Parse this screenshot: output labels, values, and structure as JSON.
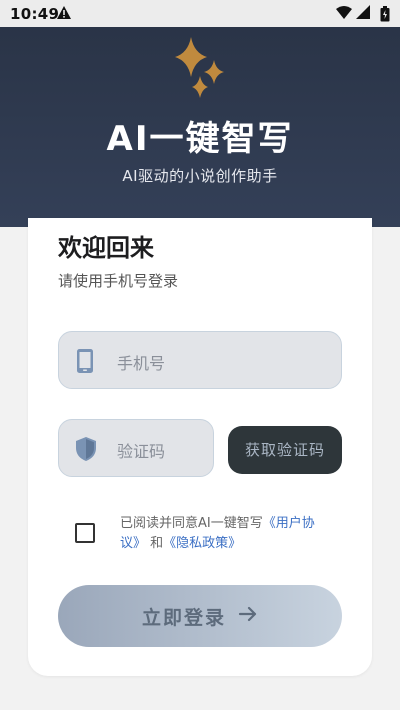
{
  "status_bar": {
    "time": "10:49"
  },
  "header": {
    "title": "AI一键智写",
    "subtitle": "AI驱动的小说创作助手",
    "logo_icon": "sparkle-stars-icon",
    "background_color": "#2a3447"
  },
  "login": {
    "welcome": "欢迎回来",
    "hint": "请使用手机号登录",
    "phone_field": {
      "placeholder": "手机号",
      "value": "",
      "icon": "smartphone-icon"
    },
    "code_field": {
      "placeholder": "验证码",
      "value": "",
      "icon": "shield-icon"
    },
    "send_code_button": "获取验证码",
    "agreement": {
      "checked": false,
      "prefix": "已阅读并同意AI一键智写",
      "user_agreement": "《用户协议》",
      "conjunction": "和",
      "privacy_policy": "《隐私政策》",
      "link_color": "#3b6fc4"
    },
    "login_button": {
      "label": "立即登录",
      "icon": "arrow-right-icon"
    }
  }
}
